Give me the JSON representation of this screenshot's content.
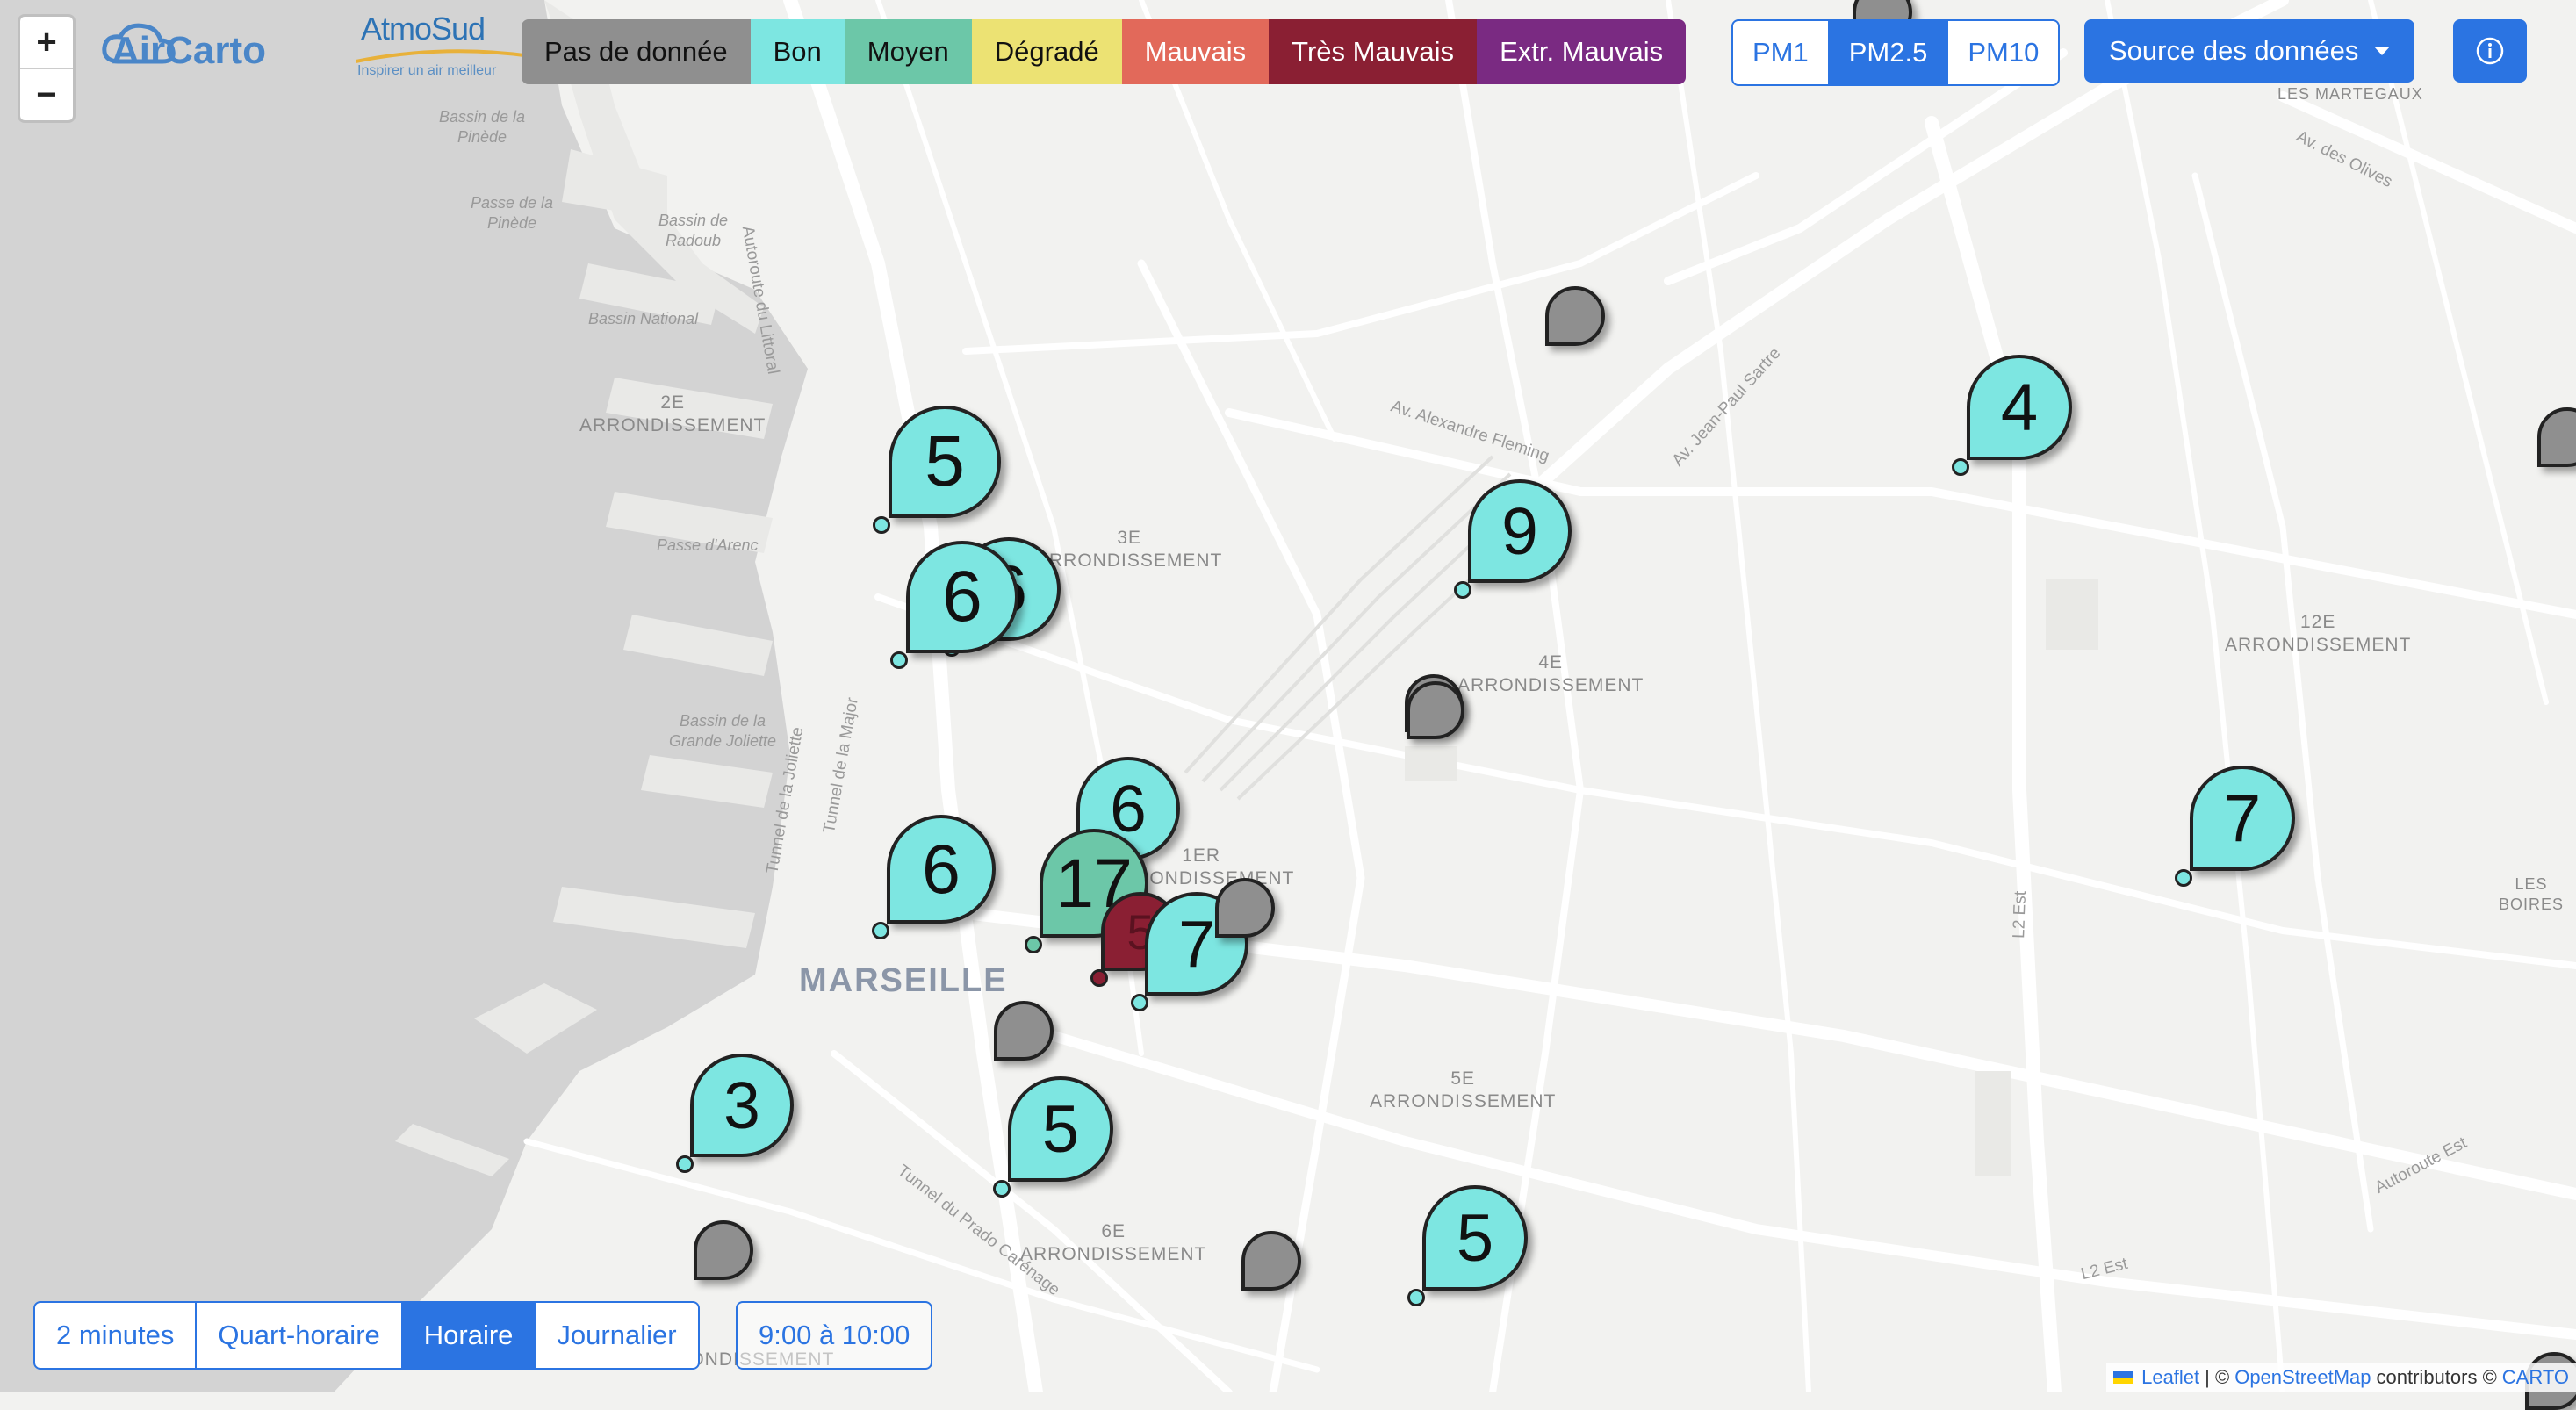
{
  "app": {
    "logo": "AirCarto",
    "partner_logo": "AtmoSud",
    "partner_tagline": "Inspirer un air meilleur"
  },
  "legend": [
    {
      "label": "Pas de donnée",
      "color": "#8f8f8f",
      "text": "#111111"
    },
    {
      "label": "Bon",
      "color": "#7de6e1",
      "text": "#111111"
    },
    {
      "label": "Moyen",
      "color": "#6cc7a8",
      "text": "#111111"
    },
    {
      "label": "Dégradé",
      "color": "#ece273",
      "text": "#111111"
    },
    {
      "label": "Mauvais",
      "color": "#e2695a",
      "text": "#ffffff"
    },
    {
      "label": "Très Mauvais",
      "color": "#8a1f33",
      "text": "#ffffff"
    },
    {
      "label": "Extr. Mauvais",
      "color": "#7a2a82",
      "text": "#ffffff"
    }
  ],
  "pollutant_buttons": [
    {
      "label": "PM1",
      "active": false
    },
    {
      "label": "PM2.5",
      "active": true
    },
    {
      "label": "PM10",
      "active": false
    }
  ],
  "source_button": "Source des données",
  "info_icon": "info-circle-icon",
  "zoom": {
    "in": "+",
    "out": "−"
  },
  "time_buttons": [
    {
      "label": "2 minutes",
      "active": false
    },
    {
      "label": "Quart-horaire",
      "active": false
    },
    {
      "label": "Horaire",
      "active": true
    },
    {
      "label": "Journalier",
      "active": false
    }
  ],
  "time_range": "9:00 à 10:00",
  "attribution": {
    "leaflet": "Leaflet",
    "sep": "| ©",
    "osm": "OpenStreetMap",
    "contrib": "contributors ©",
    "carto": "CARTO"
  },
  "colors": {
    "accent": "#2b74e2",
    "good": "#7de6e1",
    "moderate": "#6cc7a8",
    "very_bad": "#8a1f33",
    "no_data": "#8f8f8f"
  },
  "map_labels": {
    "city": "MARSEILLE",
    "arr2": [
      "2E",
      "ARRONDISSEMENT"
    ],
    "arr3": [
      "3E",
      "ARRONDISSEMENT"
    ],
    "arr4": [
      "4E",
      "ARRONDISSEMENT"
    ],
    "arr5": [
      "5E",
      "ARRONDISSEMENT"
    ],
    "arr6": [
      "6E",
      "ARRONDISSEMENT"
    ],
    "arr12": [
      "12E",
      "ARRONDISSEMENT"
    ],
    "arr1": [
      "1ER",
      "ARRONDISSEMENT"
    ],
    "arr7": "ARRONDISSEMENT",
    "bassin_pinede": [
      "Bassin de la",
      "Pinède"
    ],
    "passe_pinede": [
      "Passe de la",
      "Pinède"
    ],
    "bassin_radoub": [
      "Bassin de",
      "Radoub"
    ],
    "bassin_national": "Bassin National",
    "passe_arenc": "Passe d'Arenc",
    "bassin_joliette": [
      "Bassin de la",
      "Grande Joliette"
    ],
    "les_martegaux": "LES MARTEGAUX",
    "les_boires": "LES BOIRES",
    "av_olives": "Av. des Olives",
    "av_fleming": "Av. Alexandre Fleming",
    "av_sartre": "Av. Jean-Paul Sartre",
    "tunnel_joliette": "Tunnel de la Joliette",
    "tunnel_major": "Tunnel de la Major",
    "tunnel_prado": "Tunnel du Prado Carénage",
    "autoroute_littoral": "Autoroute du Littoral",
    "l2_est": "L2 Est",
    "autoroute_est": "Autoroute Est"
  },
  "markers": [
    {
      "value": "",
      "status": "no_data"
    },
    {
      "value": "5",
      "status": "good"
    },
    {
      "value": "6",
      "status": "good"
    },
    {
      "value": "6",
      "status": "good"
    },
    {
      "value": "9",
      "status": "good"
    },
    {
      "value": "4",
      "status": "good"
    },
    {
      "value": "",
      "status": "no_data"
    },
    {
      "value": "",
      "status": "no_data"
    },
    {
      "value": "",
      "status": "no_data"
    },
    {
      "value": "6",
      "status": "good"
    },
    {
      "value": "6",
      "status": "good"
    },
    {
      "value": "17",
      "status": "moderate"
    },
    {
      "value": "5",
      "status": "very_bad"
    },
    {
      "value": "7",
      "status": "good"
    },
    {
      "value": "7",
      "status": "good"
    },
    {
      "value": "",
      "status": "no_data"
    },
    {
      "value": "3",
      "status": "good"
    },
    {
      "value": "5",
      "status": "good"
    },
    {
      "value": "",
      "status": "no_data"
    },
    {
      "value": "",
      "status": "no_data"
    },
    {
      "value": "5",
      "status": "good"
    },
    {
      "value": "",
      "status": "no_data"
    },
    {
      "value": "",
      "status": "no_data"
    },
    {
      "value": "",
      "status": "no_data"
    }
  ]
}
